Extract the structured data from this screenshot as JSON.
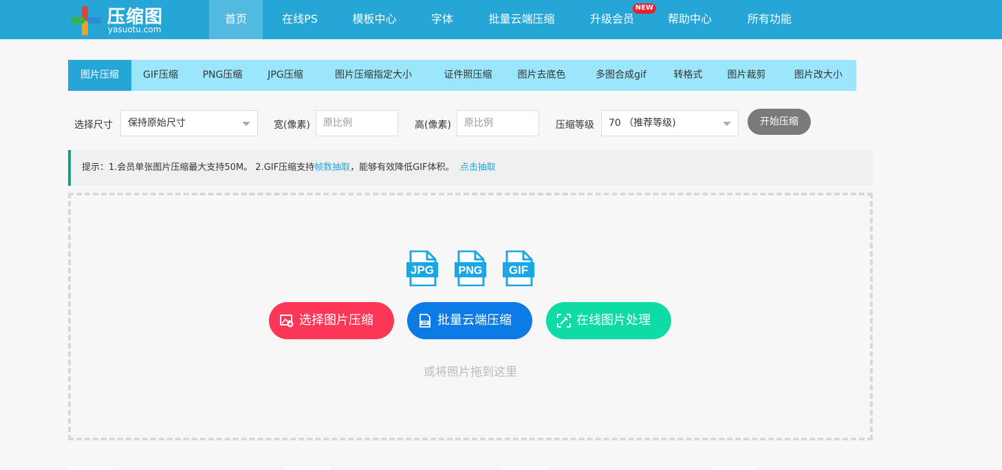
{
  "header": {
    "logo_title": "压缩图",
    "logo_sub": "yasuotu.com",
    "nav": [
      {
        "label": "首页",
        "active": true
      },
      {
        "label": "在线PS"
      },
      {
        "label": "模板中心"
      },
      {
        "label": "字体"
      },
      {
        "label": "批量云端压缩"
      },
      {
        "label": "升级会员",
        "badge": "NEW"
      },
      {
        "label": "帮助中心"
      },
      {
        "label": "所有功能"
      }
    ]
  },
  "tabs": [
    "图片压缩",
    "GIF压缩",
    "PNG压缩",
    "JPG压缩",
    "图片压缩指定大小",
    "证件照压缩",
    "图片去底色",
    "多图合成gif",
    "转格式",
    "图片裁剪",
    "图片改大小"
  ],
  "options": {
    "size_label": "选择尺寸",
    "size_value": "保持原始尺寸",
    "width_label": "宽(像素)",
    "width_placeholder": "原比例",
    "height_label": "高(像素)",
    "height_placeholder": "原比例",
    "level_label": "压缩等级",
    "level_value": "70 （推荐等级)",
    "start_button": "开始压缩"
  },
  "tip": {
    "prefix": "提示：1.会员单张图片压缩最大支持50M。 2.GIF压缩支持",
    "link1": "帧数抽取",
    "middle": "，能够有效降低GIF体积。",
    "link2": "点击抽取"
  },
  "upload": {
    "file_types": [
      "JPG",
      "PNG",
      "GIF"
    ],
    "buttons": [
      {
        "label": "选择图片压缩",
        "color": "#fb3657"
      },
      {
        "label": "批量云端压缩",
        "color": "#0c7be5"
      },
      {
        "label": "在线图片处理",
        "color": "#0fdba6"
      }
    ],
    "drag_hint": "或将照片拖到这里"
  },
  "colors": {
    "brand": "#25a6d7",
    "tab_bg": "#9ce6fc",
    "file_icon": "#1aa8e5"
  }
}
